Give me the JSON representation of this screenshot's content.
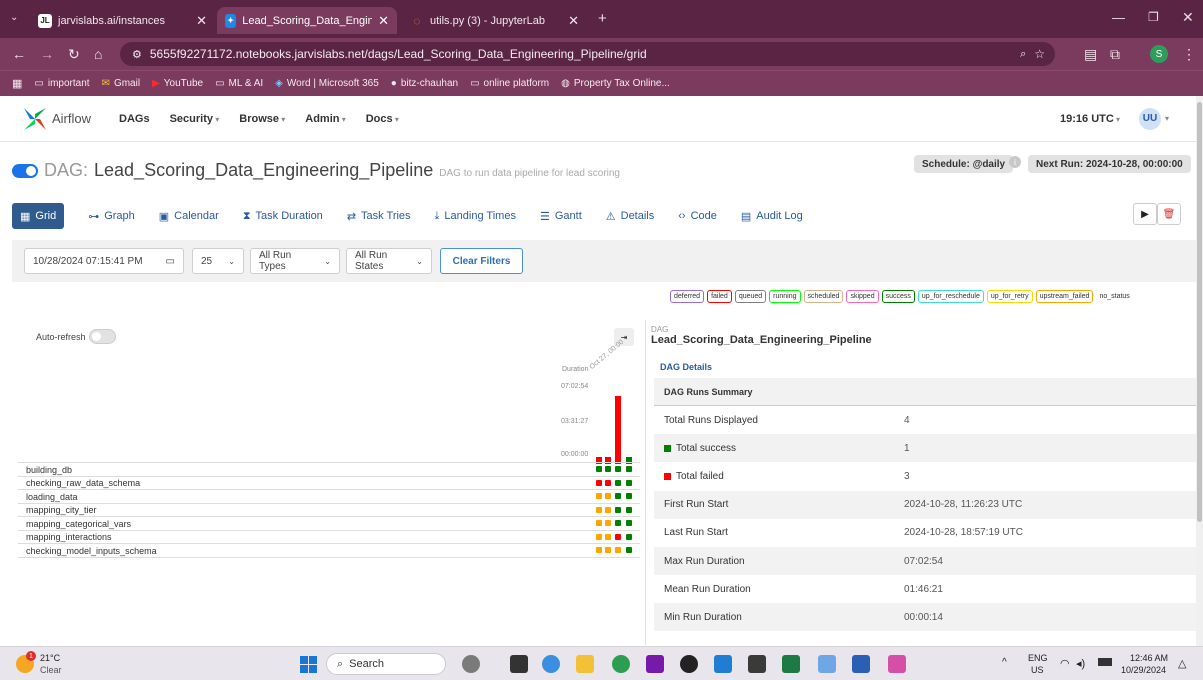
{
  "browser": {
    "tabs": [
      {
        "label": "jarvislabs.ai/instances",
        "favicon": "JL"
      },
      {
        "label": "Lead_Scoring_Data_Engineering",
        "favicon": "airflow-icon"
      },
      {
        "label": "utils.py (3) - JupyterLab",
        "favicon": "jupyter-icon"
      }
    ],
    "url": "5655f92271172.notebooks.jarvislabs.net/dags/Lead_Scoring_Data_Engineering_Pipeline/grid",
    "bookmarks": [
      "important",
      "Gmail",
      "YouTube",
      "ML & AI",
      "Word | Microsoft 365",
      "bitz-chauhan",
      "online platform",
      "Property Tax Online..."
    ],
    "profile_initial": "S"
  },
  "airflow_nav": {
    "brand": "Airflow",
    "items": [
      "DAGs",
      "Security",
      "Browse",
      "Admin",
      "Docs"
    ],
    "time": "19:16 UTC",
    "user": "UU"
  },
  "dag": {
    "prefix": "DAG:",
    "name": "Lead_Scoring_Data_Engineering_Pipeline",
    "description": "DAG to run data pipeline for lead scoring",
    "schedule": "Schedule: @daily",
    "next_run": "Next Run: 2024-10-28, 00:00:00"
  },
  "view_tabs": [
    "Grid",
    "Graph",
    "Calendar",
    "Task Duration",
    "Task Tries",
    "Landing Times",
    "Gantt",
    "Details",
    "Code",
    "Audit Log"
  ],
  "filters": {
    "date": "10/28/2024 07:15:41 PM",
    "count": "25",
    "run_types": "All Run Types",
    "run_states": "All Run States",
    "clear": "Clear Filters"
  },
  "legend": [
    {
      "label": "deferred",
      "color": "#9370db"
    },
    {
      "label": "failed",
      "color": "#ff0000"
    },
    {
      "label": "queued",
      "color": "#808080"
    },
    {
      "label": "running",
      "color": "#00ff00"
    },
    {
      "label": "scheduled",
      "color": "#d2b48c"
    },
    {
      "label": "skipped",
      "color": "#ff69b4"
    },
    {
      "label": "success",
      "color": "#008000"
    },
    {
      "label": "up_for_reschedule",
      "color": "#40e0d0"
    },
    {
      "label": "up_for_retry",
      "color": "#ffd700"
    },
    {
      "label": "upstream_failed",
      "color": "#ffa500"
    },
    {
      "label": "no_status",
      "color": "#ffffff"
    }
  ],
  "grid": {
    "auto_refresh": "Auto-refresh",
    "duration_label": "Duration",
    "run_date_label": "Oct 27, 00:00",
    "duration_ticks": [
      "07:02:54",
      "03:31:27",
      "00:00:00"
    ],
    "runs": [
      {
        "state": "failed",
        "duration_fraction": 0.03
      },
      {
        "state": "failed",
        "duration_fraction": 0.03
      },
      {
        "state": "failed",
        "duration_fraction": 1.0
      },
      {
        "state": "success",
        "duration_fraction": 0.03
      }
    ],
    "tasks": [
      {
        "name": "building_db",
        "states": [
          "success",
          "success",
          "success",
          "success"
        ]
      },
      {
        "name": "checking_raw_data_schema",
        "states": [
          "failed",
          "failed",
          "success",
          "success"
        ]
      },
      {
        "name": "loading_data",
        "states": [
          "upstream_failed",
          "upstream_failed",
          "success",
          "success"
        ]
      },
      {
        "name": "mapping_city_tier",
        "states": [
          "upstream_failed",
          "upstream_failed",
          "success",
          "success"
        ]
      },
      {
        "name": "mapping_categorical_vars",
        "states": [
          "upstream_failed",
          "upstream_failed",
          "success",
          "success"
        ]
      },
      {
        "name": "mapping_interactions",
        "states": [
          "upstream_failed",
          "upstream_failed",
          "failed",
          "success"
        ]
      },
      {
        "name": "checking_model_inputs_schema",
        "states": [
          "upstream_failed",
          "upstream_failed",
          "upstream_failed",
          "success"
        ]
      }
    ]
  },
  "details": {
    "dag_label": "DAG",
    "dag_name": "Lead_Scoring_Data_Engineering_Pipeline",
    "link": "DAG Details",
    "section": "DAG Runs Summary",
    "rows": [
      {
        "label": "Total Runs Displayed",
        "value": "4"
      },
      {
        "label": "Total success",
        "value": "1"
      },
      {
        "label": "Total failed",
        "value": "3"
      },
      {
        "label": "First Run Start",
        "value": "2024-10-28, 11:26:23 UTC"
      },
      {
        "label": "Last Run Start",
        "value": "2024-10-28, 18:57:19 UTC"
      },
      {
        "label": "Max Run Duration",
        "value": "07:02:54"
      },
      {
        "label": "Mean Run Duration",
        "value": "01:46:21"
      },
      {
        "label": "Min Run Duration",
        "value": "00:00:14"
      }
    ]
  },
  "taskbar": {
    "weather_temp": "21°C",
    "weather_desc": "Clear",
    "search": "Search",
    "lang": "ENG",
    "region": "US",
    "time": "12:46 AM",
    "date": "10/29/2024",
    "notification_count": "1"
  },
  "colors": {
    "success": "#008000",
    "failed": "#ff0000",
    "upstream_failed": "#ffa500",
    "browser_dark": "#5a2545",
    "browser_mid": "#7a3b5e"
  }
}
